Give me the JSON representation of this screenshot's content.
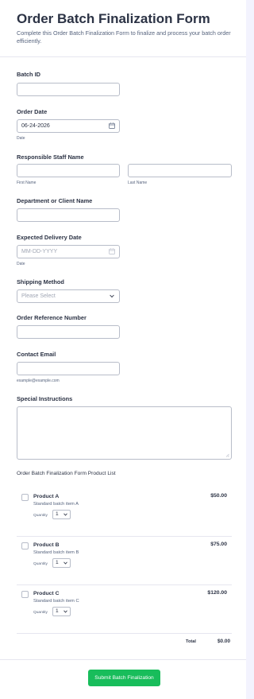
{
  "form": {
    "title": "Order Batch Finalization Form",
    "subtitle": "Complete this Order Batch Finalization Form to finalize and process your batch order efficiently."
  },
  "fields": {
    "batch_id": {
      "label": "Batch ID",
      "value": ""
    },
    "order_date": {
      "label": "Order Date",
      "value": "06-24-2026",
      "sublabel": "Date"
    },
    "staff_name": {
      "label": "Responsible Staff Name",
      "first_sublabel": "First Name",
      "last_sublabel": "Last Name"
    },
    "department": {
      "label": "Department or Client Name"
    },
    "delivery_date": {
      "label": "Expected Delivery Date",
      "placeholder": "MM-DD-YYYY",
      "sublabel": "Date"
    },
    "shipping": {
      "label": "Shipping Method",
      "placeholder": "Please Select"
    },
    "order_ref": {
      "label": "Order Reference Number"
    },
    "email": {
      "label": "Contact Email",
      "sublabel": "example@example.com"
    },
    "instructions": {
      "label": "Special Instructions"
    }
  },
  "product_list": {
    "title": "Order Batch Finalization Form Product List",
    "quantity_label": "Quantity",
    "items": [
      {
        "name": "Product A",
        "description": "Standard batch item A",
        "price": "$50.00",
        "quantity": "1"
      },
      {
        "name": "Product B",
        "description": "Standard batch item B",
        "price": "$75.00",
        "quantity": "1"
      },
      {
        "name": "Product C",
        "description": "Standard batch item C",
        "price": "$120.00",
        "quantity": "1"
      }
    ],
    "total_label": "Total",
    "total_value": "$0.00"
  },
  "submit_label": "Submit Batch Finalization",
  "icons": {
    "date_icon": "calendar-icon",
    "select_icon": "chevron-down-icon",
    "resize_icon": "resize-handle-icon"
  },
  "colors": {
    "submit": "#18bd5b",
    "text": "#2c3345",
    "muted": "#57647e",
    "border": "#b8bdc9"
  }
}
